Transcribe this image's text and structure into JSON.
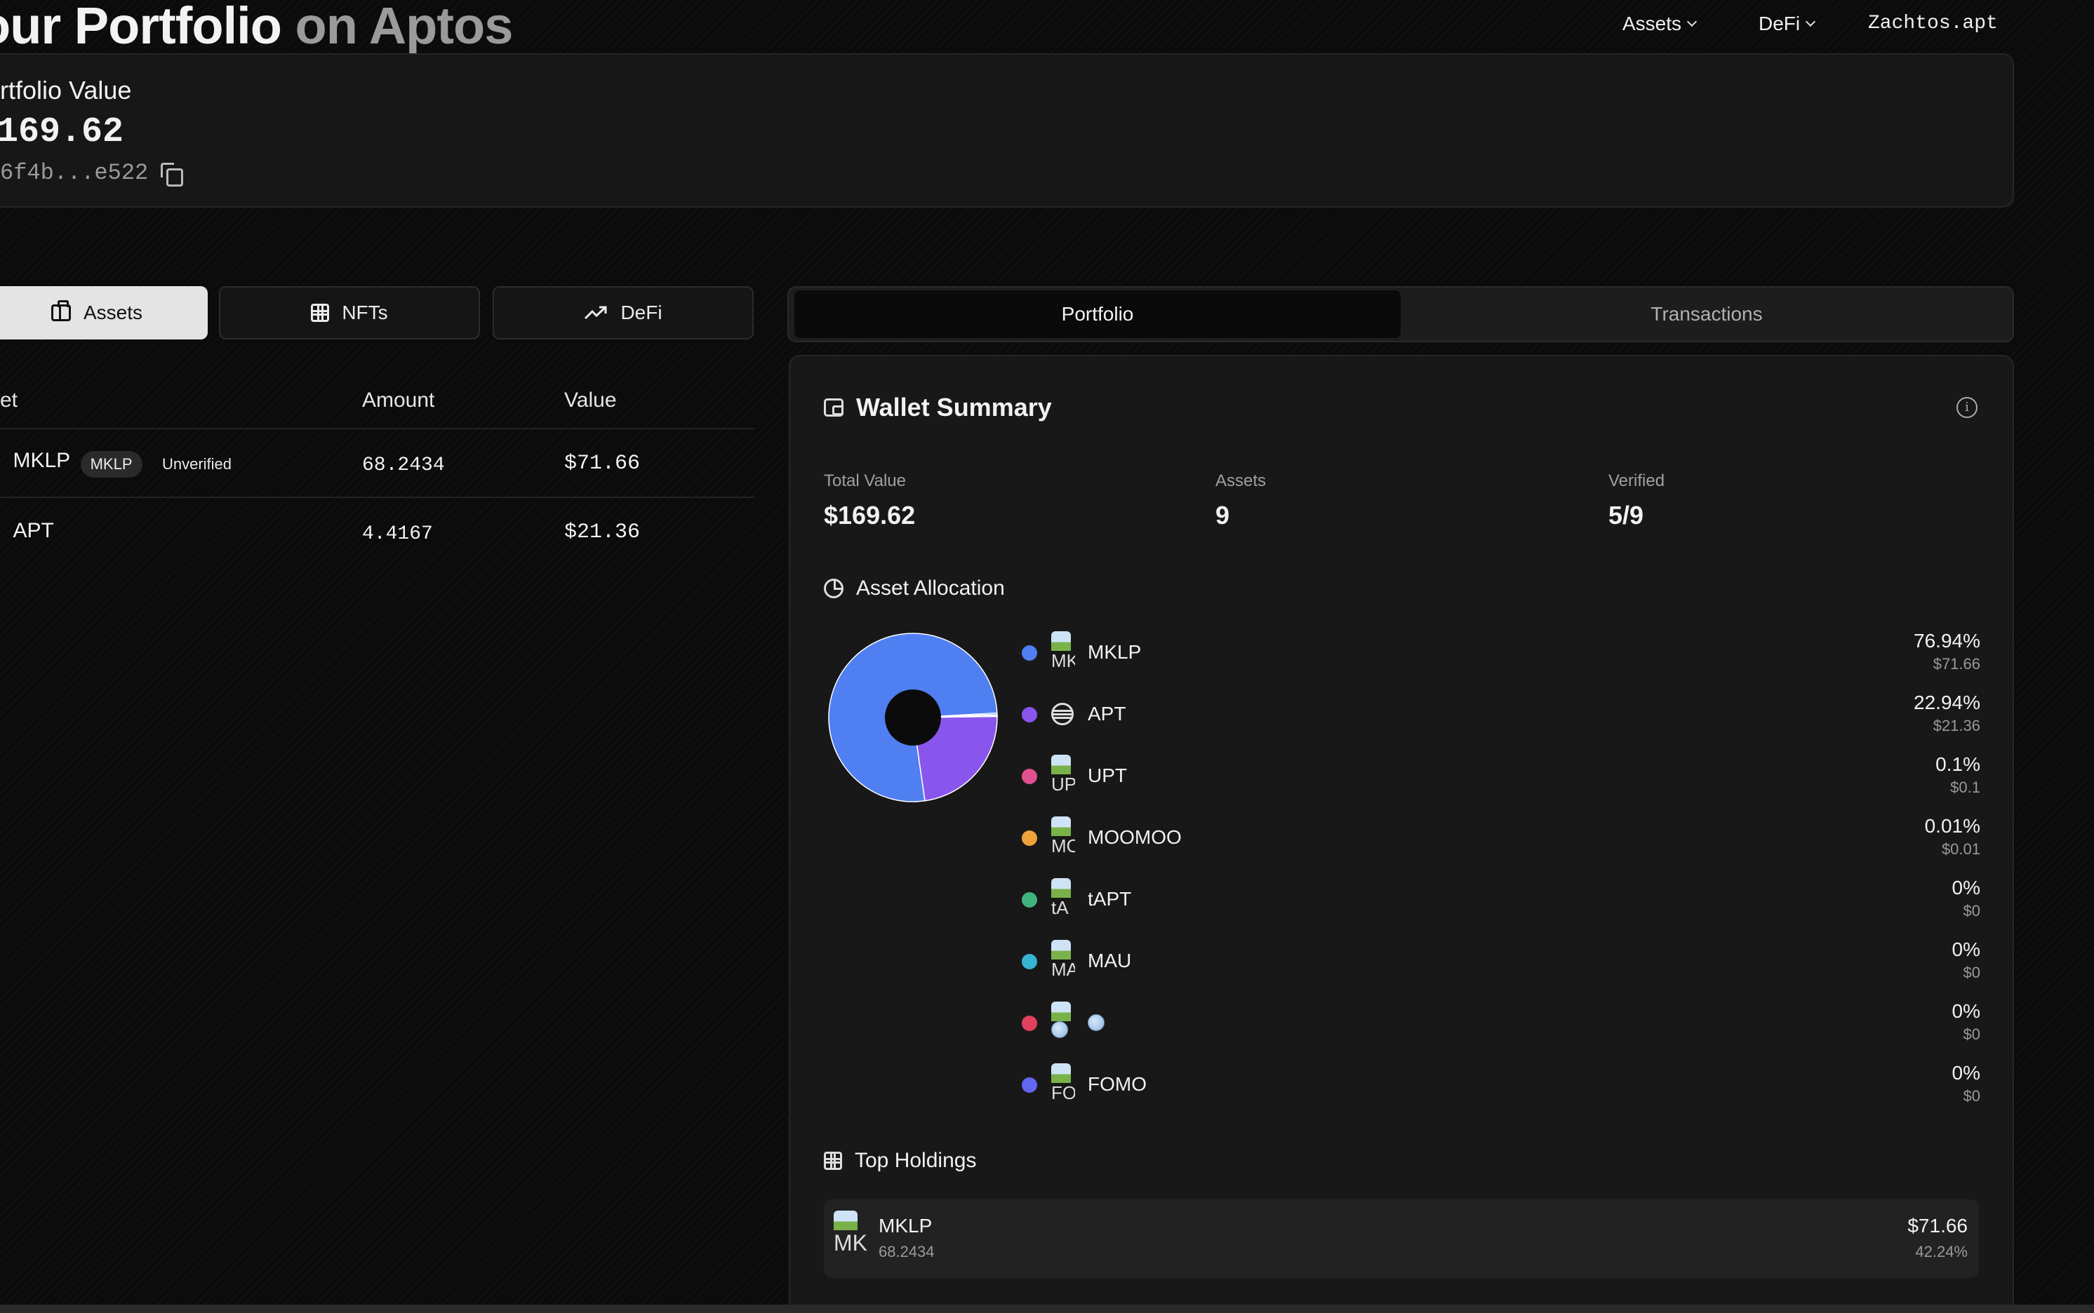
{
  "header": {
    "title_main": "our Portfolio",
    "title_muted": "on Aptos"
  },
  "nav": {
    "assets": "Assets",
    "defi": "DeFi",
    "account": "Zachtos.apt"
  },
  "portfolio": {
    "label": "rtfolio Value",
    "value": "169.62",
    "address": "6f4b...e522"
  },
  "left_tabs": {
    "assets": "Assets",
    "nfts": "NFTs",
    "defi": "DeFi"
  },
  "asset_table": {
    "headers": {
      "asset": "et",
      "amount": "Amount",
      "value": "Value"
    },
    "rows": [
      {
        "name": "MKLP",
        "ticker": "MKLP",
        "status": "Unverified",
        "amount": "68.2434",
        "value": "$71.66"
      },
      {
        "name": "APT",
        "amount": "4.4167",
        "value": "$21.36"
      }
    ]
  },
  "right_tabs": {
    "portfolio": "Portfolio",
    "transactions": "Transactions"
  },
  "wallet_summary": {
    "title": "Wallet Summary",
    "stats": {
      "total_value_label": "Total Value",
      "total_value": "$169.62",
      "assets_label": "Assets",
      "assets": "9",
      "verified_label": "Verified",
      "verified": "5/9"
    }
  },
  "allocation": {
    "title": "Asset Allocation",
    "items": [
      {
        "name": "MKLP",
        "img_alt": "MK",
        "pct": "76.94%",
        "usd": "$71.66",
        "color": "#4f7ff0"
      },
      {
        "name": "APT",
        "img_alt": "",
        "pct": "22.94%",
        "usd": "$21.36",
        "color": "#8a55ec"
      },
      {
        "name": "UPT",
        "img_alt": "UP",
        "pct": "0.1%",
        "usd": "$0.1",
        "color": "#e0508f"
      },
      {
        "name": "MOOMOO",
        "img_alt": "MO",
        "pct": "0.01%",
        "usd": "$0.01",
        "color": "#f0a23a"
      },
      {
        "name": "tAPT",
        "img_alt": "tA",
        "pct": "0%",
        "usd": "$0",
        "color": "#3fb57e"
      },
      {
        "name": "MAU",
        "img_alt": "MA",
        "pct": "0%",
        "usd": "$0",
        "color": "#36b4d2"
      },
      {
        "name": "",
        "img_alt": "",
        "pct": "0%",
        "usd": "$0",
        "color": "#e3405f"
      },
      {
        "name": "FOMO",
        "img_alt": "FO",
        "pct": "0%",
        "usd": "$0",
        "color": "#6366f0"
      }
    ]
  },
  "chart_data": {
    "type": "pie",
    "donut": true,
    "categories": [
      "MKLP",
      "APT",
      "UPT",
      "MOOMOO",
      "tAPT",
      "MAU",
      "",
      "FOMO"
    ],
    "values": [
      76.94,
      22.94,
      0.1,
      0.01,
      0,
      0,
      0,
      0
    ],
    "colors": [
      "#4f7ff0",
      "#8a55ec",
      "#e0508f",
      "#f0a23a",
      "#3fb57e",
      "#36b4d2",
      "#e3405f",
      "#6366f0"
    ]
  },
  "top_holdings": {
    "title": "Top Holdings",
    "items": [
      {
        "name": "MKLP",
        "img_alt": "MK",
        "amount": "68.2434",
        "value": "$71.66",
        "pct": "42.24%"
      }
    ]
  }
}
